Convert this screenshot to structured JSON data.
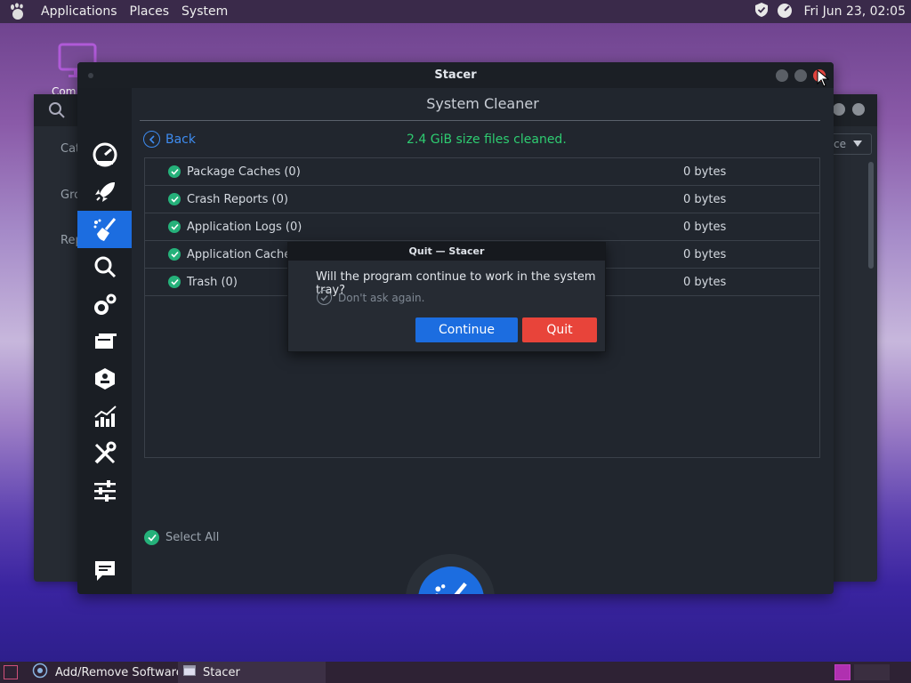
{
  "top_panel": {
    "menus": [
      "Applications",
      "Places",
      "System"
    ],
    "clock": "Fri Jun 23, 02:05"
  },
  "desktop": {
    "icon_label": "Com"
  },
  "background_window": {
    "sidebar_items": [
      "Cat",
      "Gro",
      "Rep"
    ],
    "dropdown_value": "ce"
  },
  "window": {
    "title": "Stacer",
    "page_title": "System Cleaner",
    "back_label": "Back",
    "status": "2.4 GiB size files cleaned.",
    "sidebar_icons": [
      "dashboard-icon",
      "startup-rocket-icon",
      "cleaner-broom-icon",
      "search-icon",
      "services-gears-icon",
      "uninstaller-icon",
      "resources-icon",
      "chart-icon",
      "tools-icon",
      "settings-sliders-icon",
      "feedback-icon"
    ],
    "items": [
      {
        "name": "Package Caches (0)",
        "size": "0 bytes"
      },
      {
        "name": "Crash Reports (0)",
        "size": "0 bytes"
      },
      {
        "name": "Application Logs (0)",
        "size": "0 bytes"
      },
      {
        "name": "Application Caches",
        "size": "0 bytes"
      },
      {
        "name": "Trash (0)",
        "size": "0 bytes"
      }
    ],
    "select_all_label": "Select All"
  },
  "dialog": {
    "title": "Quit — Stacer",
    "question": "Will the program continue to work in the system tray?",
    "dont_ask_label": "Don't ask again.",
    "continue_label": "Continue",
    "quit_label": "Quit"
  },
  "taskbar": {
    "tasks": [
      "Add/Remove Software",
      "Stacer"
    ]
  },
  "colors": {
    "accent": "#1c6de0",
    "success": "#2ecc71",
    "danger": "#e8443a"
  }
}
